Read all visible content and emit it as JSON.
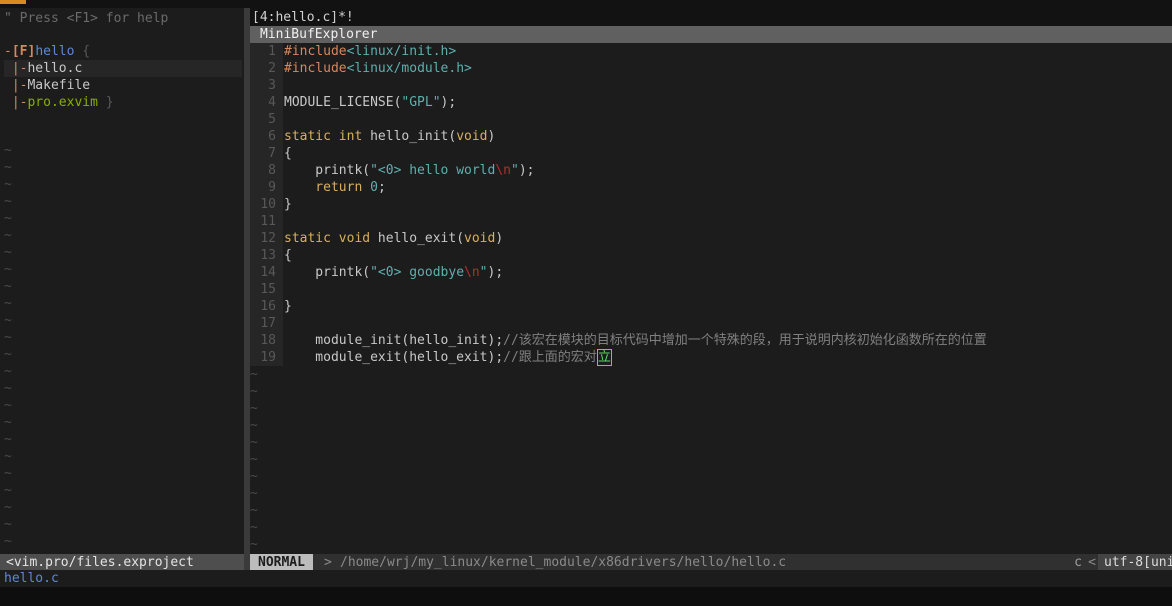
{
  "help_hint": "\" Press <F1> for help",
  "project": {
    "flag": "[F]",
    "root": "hello",
    "root_brace": " {",
    "files": [
      {
        "name": "hello.c"
      },
      {
        "name": "Makefile"
      },
      {
        "name": "pro.exvim",
        "suffix": " }"
      }
    ]
  },
  "tab": "[4:hello.c]*!",
  "minibuf": "MiniBufExplorer",
  "code_lines": [
    {
      "n": "1"
    },
    {
      "n": "2"
    },
    {
      "n": "3"
    },
    {
      "n": "4"
    },
    {
      "n": "5"
    },
    {
      "n": "6"
    },
    {
      "n": "7"
    },
    {
      "n": "8"
    },
    {
      "n": "9"
    },
    {
      "n": "10"
    },
    {
      "n": "11"
    },
    {
      "n": "12"
    },
    {
      "n": "13"
    },
    {
      "n": "14"
    },
    {
      "n": "15"
    },
    {
      "n": "16"
    },
    {
      "n": "17"
    },
    {
      "n": "18"
    },
    {
      "n": "19"
    }
  ],
  "code": {
    "include_kw": "#include",
    "include1": "<linux/init.h>",
    "include2": "<linux/module.h>",
    "license_fn": "MODULE_LICENSE(",
    "license_str": "\"GPL\"",
    "license_end": ");",
    "static_kw": "static",
    "int_kw": "int",
    "void_kw": "void",
    "hello_init": " hello_init(",
    "hello_exit": " hello_exit(",
    "close_paren": ")",
    "open_brace": "{",
    "close_brace": "}",
    "printk_open": "    printk(",
    "quote": "\"",
    "hello_msg": "<0> hello world",
    "bye_msg": "<0> goodbye",
    "newline_esc": "\\n",
    "printk_close": ");",
    "return_kw": "    return",
    "zero": " 0",
    "semicolon": ";",
    "module_init": "    module_init(hello_init);",
    "module_exit": "    module_exit(hello_exit);",
    "comment18": "//该宏在模块的目标代码中增加一个特殊的段，用于说明内核初始化函数所在的位置",
    "comment19": "//跟上面的宏对",
    "cursor_char": "立"
  },
  "tilde": "~",
  "status": {
    "left_file": "<vim.pro/files.exproject",
    "mode": "NORMAL",
    "arrow": ">",
    "path": "/home/wrj/my_linux/kernel_module/x86drivers/hello/hello.c",
    "filetype": "c",
    "arrow2": "<",
    "encoding": "utf-8[unix]"
  },
  "cmdline": "hello.c",
  "colors": {
    "accent": "#d98a1f",
    "cursor": "#5fd75f"
  }
}
